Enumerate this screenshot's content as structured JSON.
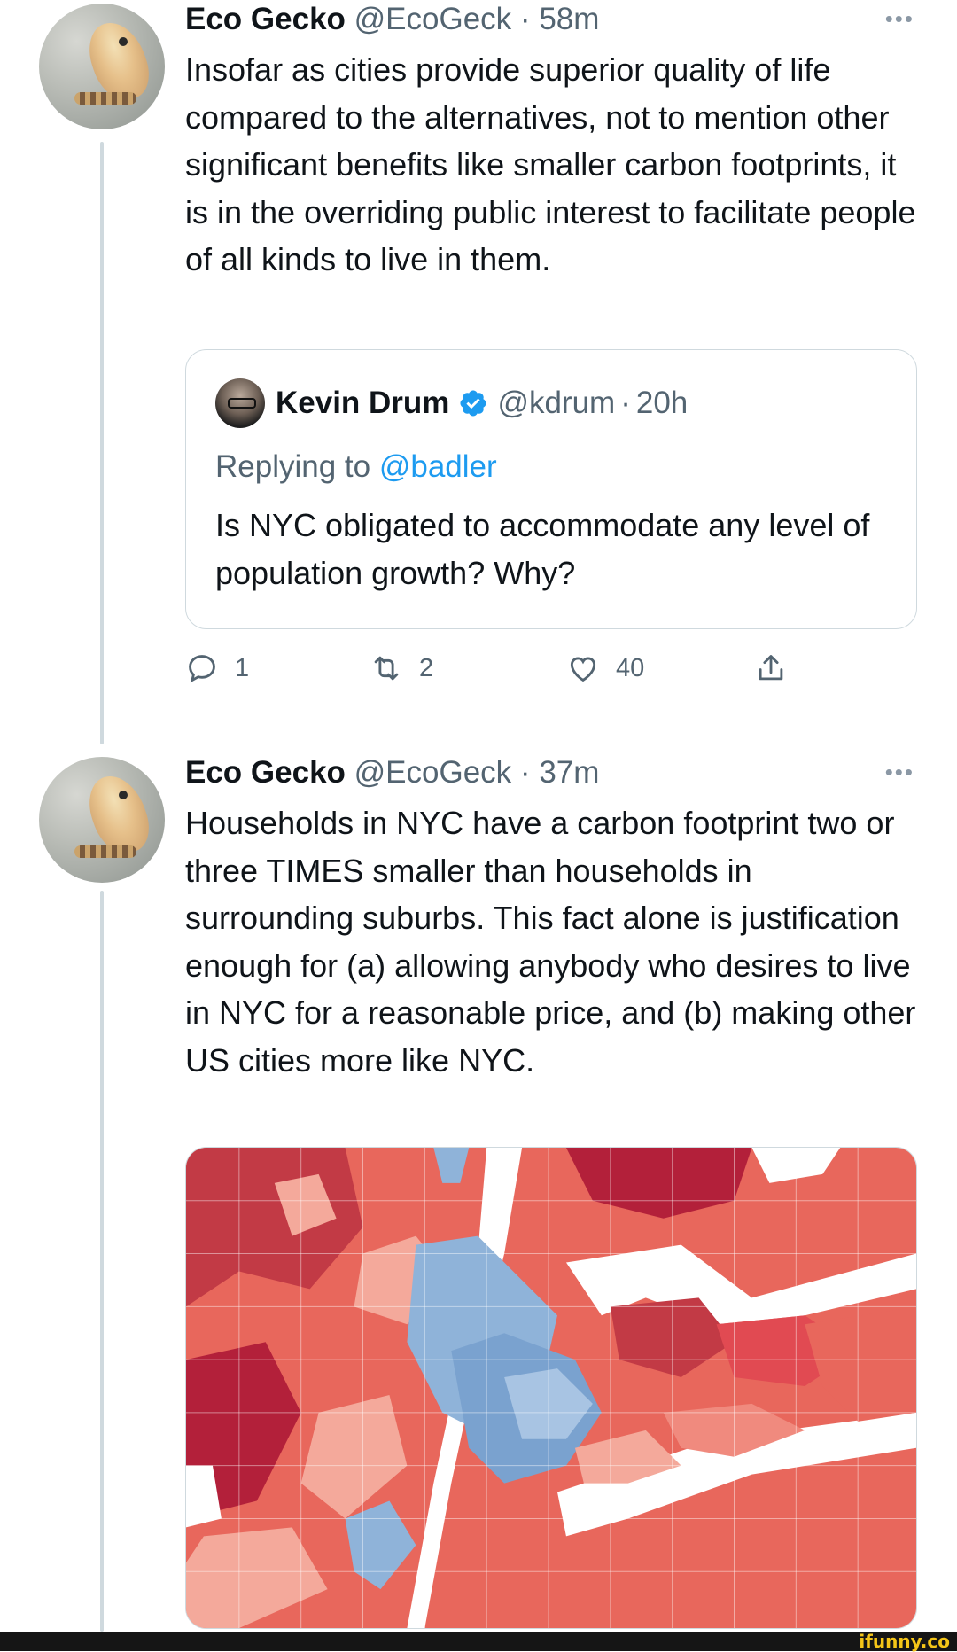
{
  "tweets": [
    {
      "author_name": "Eco Gecko",
      "author_handle": "@EcoGeck",
      "separator": "·",
      "time": "58m",
      "text": "Insofar as cities provide superior quality of life compared to the alternatives, not to mention other significant benefits like smaller carbon footprints, it is in the overriding public interest to facilitate people of all kinds to live in them.",
      "quote": {
        "author_name": "Kevin Drum",
        "author_handle": "@kdrum",
        "separator": "·",
        "time": "20h",
        "replying_prefix": "Replying to",
        "replying_to": "@badler",
        "text": "Is NYC obligated to accommodate any level of population growth? Why?"
      },
      "stats": {
        "replies": "1",
        "retweets": "2",
        "likes": "40"
      }
    },
    {
      "author_name": "Eco Gecko",
      "author_handle": "@EcoGeck",
      "separator": "·",
      "time": "37m",
      "text": "Households in NYC have a carbon footprint two or three TIMES smaller than households in surrounding suburbs. This fact alone is justification enough for (a) allowing anybody who desires to live in NYC for a reasonable price, and (b) making other US cities more like NYC."
    }
  ],
  "more_glyph": "•••",
  "watermark": "ifunny.co",
  "icons": [
    "reply-icon",
    "retweet-icon",
    "like-icon",
    "share-icon",
    "verified-badge-icon",
    "more-icon"
  ],
  "colors": {
    "text": "#0f1419",
    "secondary": "#536471",
    "link": "#1d9bf0",
    "border": "#cfd9de",
    "map_high": "#b3203a",
    "map_mid": "#e8675c",
    "map_low": "#f4a99b",
    "map_cool": "#8fb3d9"
  }
}
